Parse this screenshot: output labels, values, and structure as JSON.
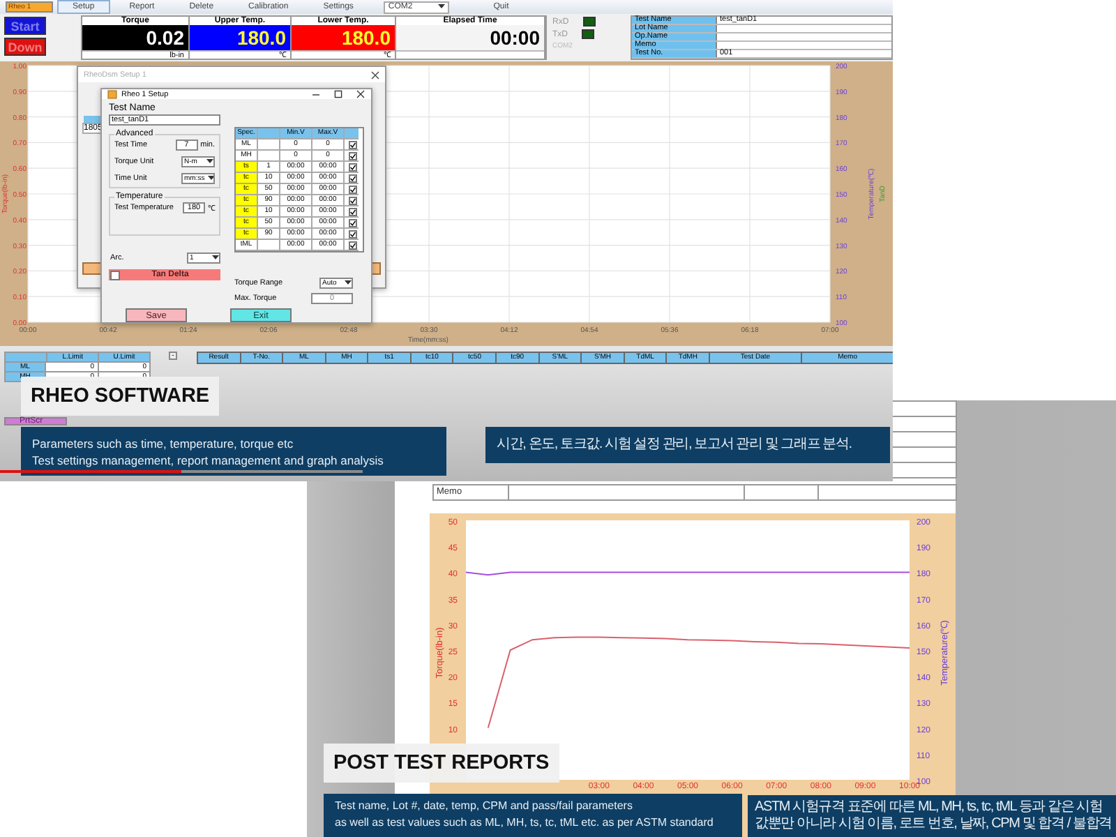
{
  "software": {
    "menu": [
      {
        "label": "Rheo 1",
        "selected": true,
        "focused": false
      },
      {
        "label": "Setup",
        "selected": false,
        "focused": true
      },
      {
        "label": "Report",
        "selected": false,
        "focused": false
      },
      {
        "label": "Delete",
        "selected": false,
        "focused": false
      },
      {
        "label": "Calibration",
        "selected": false,
        "focused": false
      },
      {
        "label": "Settings",
        "selected": false,
        "focused": false
      }
    ],
    "port": "COM2",
    "quit": "Quit",
    "buttons": [
      {
        "label": "Start",
        "color": "#1414d8"
      },
      {
        "label": "Down",
        "color": "#e01010"
      }
    ],
    "gauges": [
      {
        "label": "Torque",
        "value": "0.02",
        "unit": "lb-in",
        "color": "#000000"
      },
      {
        "label": "Upper Temp.",
        "value": "180.0",
        "unit": "℃",
        "color": "#0000ff"
      },
      {
        "label": "Lower Temp.",
        "value": "180.0",
        "unit": "℃",
        "color": "#ff0000"
      },
      {
        "label": "Elapsed Time",
        "value": "00:00"
      }
    ],
    "leds": [
      {
        "label": "RxD"
      },
      {
        "label": "TxD"
      }
    ],
    "led_port": "COM2",
    "info": [
      {
        "label": "Test Name",
        "value": "test_tanD1"
      },
      {
        "label": "Lot Name"
      },
      {
        "label": "Op.Name"
      },
      {
        "label": "Memo"
      },
      {
        "label": "Test No.",
        "value": "001"
      }
    ],
    "chart": {
      "left_label": "Torque(lb-in)",
      "right_label": "Temperature(℃)",
      "extra_label": "TanD",
      "xlabel": "Time(mm:ss)",
      "left_ticks": [
        "1.00",
        "0.90",
        "0.80",
        "0.70",
        "0.60",
        "0.50",
        "0.40",
        "0.30",
        "0.20",
        "0.10",
        "0.00"
      ],
      "right_ticks": [
        "200",
        "190",
        "180",
        "170",
        "160",
        "150",
        "140",
        "130",
        "120",
        "110",
        "100"
      ],
      "x_ticks": [
        "00:00",
        "00:42",
        "01:24",
        "02:06",
        "02:48",
        "03:30",
        "04:12",
        "04:54",
        "05:36",
        "06:18",
        "07:00"
      ]
    },
    "limits": {
      "columns": [
        "L.Limit",
        "U.Limit"
      ],
      "rows": [
        {
          "name": "ML",
          "values": [
            "0",
            "0"
          ]
        },
        {
          "name": "MH",
          "values": [
            "0",
            "0"
          ]
        }
      ]
    },
    "print_button": "PrtScr",
    "collapse_button": "-",
    "results_columns": [
      "Result",
      "T-No.",
      "ML",
      "MH",
      "ts1",
      "tc10",
      "tc50",
      "tc90",
      "S'ML",
      "S'MH",
      "TdML",
      "TdMH",
      "Test Date",
      "Memo"
    ],
    "back_dialog": {
      "title": "RheoDsm Setup 1",
      "cell": "1805"
    },
    "setup": {
      "title": "Rheo 1 Setup",
      "test_name_label": "Test Name",
      "test_name": "test_tanD1",
      "advanced_label": "Advanced",
      "test_time_label": "Test Time",
      "test_time": "7",
      "test_time_unit": "min.",
      "torque_unit_label": "Torque Unit",
      "torque_unit": "N-m",
      "time_unit_label": "Time Unit",
      "time_unit": "mm:ss",
      "temperature_label": "Temperature",
      "test_temp_label": "Test Temperature",
      "test_temp": "180",
      "test_temp_unit": "℃",
      "arc_label": "Arc.",
      "arc": "1",
      "tan_delta": {
        "label": "Tan Delta",
        "checked": false
      },
      "torque_range_label": "Torque Range",
      "torque_range": "Auto",
      "max_torque_label": "Max. Torque",
      "max_torque": "0",
      "save": "Save",
      "exit": "Exit",
      "spec_columns": [
        "Spec.",
        "Min.V",
        "Max.V"
      ],
      "spec_rows": [
        {
          "spec": "ML",
          "min": "0",
          "max": "0",
          "checked": true,
          "highlighted": false
        },
        {
          "spec": "MH",
          "min": "0",
          "max": "0",
          "checked": true,
          "highlighted": false
        },
        {
          "spec": "ts",
          "param": "1",
          "min": "00:00",
          "max": "00:00",
          "checked": true,
          "highlighted": true
        },
        {
          "spec": "tc",
          "param": "10",
          "min": "00:00",
          "max": "00:00",
          "checked": true,
          "highlighted": true
        },
        {
          "spec": "tc",
          "param": "50",
          "min": "00:00",
          "max": "00:00",
          "checked": true,
          "highlighted": true
        },
        {
          "spec": "tc",
          "param": "90",
          "min": "00:00",
          "max": "00:00",
          "checked": true,
          "highlighted": true
        },
        {
          "spec": "tc",
          "param": "10",
          "min": "00:00",
          "max": "00:00",
          "checked": true,
          "highlighted": true
        },
        {
          "spec": "tc",
          "param": "50",
          "min": "00:00",
          "max": "00:00",
          "checked": true,
          "highlighted": true
        },
        {
          "spec": "tc",
          "param": "90",
          "min": "00:00",
          "max": "00:00",
          "checked": true,
          "highlighted": true
        },
        {
          "spec": "tML",
          "min": "00:00",
          "max": "00:00",
          "checked": true,
          "highlighted": false
        }
      ]
    },
    "caption": {
      "title": "RHEO SOFTWARE",
      "lines": [
        "Parameters such as time, temperature, torque etc",
        "Test settings management, report management and graph analysis"
      ],
      "translation": "시간, 온도, 토크값. 시험 설정 관리, 보고서 관리 및 그래프 분석."
    },
    "progress": {
      "level": 0.5
    }
  },
  "report": {
    "memo_label": "Memo",
    "chart_data": {
      "type": "line",
      "ylabel": "Torque(lb-in)",
      "ylim": [
        0,
        50
      ],
      "yticks": [
        10,
        15,
        20,
        25,
        30,
        35,
        40,
        45,
        50
      ],
      "x": [
        0.5,
        1,
        1.5,
        2,
        2.5,
        3,
        3.5,
        4,
        4.5,
        5,
        5.5,
        6,
        6.5,
        7,
        7.5,
        8,
        8.5,
        9,
        9.5,
        10
      ],
      "xlim": [
        0,
        10
      ],
      "xticks": [
        {
          "value": 3,
          "label": "03:00"
        },
        {
          "value": 4,
          "label": "04:00"
        },
        {
          "value": 5,
          "label": "05:00"
        },
        {
          "value": 6,
          "label": "06:00"
        },
        {
          "value": 7,
          "label": "07:00"
        },
        {
          "value": 8,
          "label": "08:00"
        },
        {
          "value": 9,
          "label": "09:00"
        },
        {
          "value": 10,
          "label": "10:00"
        }
      ],
      "values": [
        10,
        25,
        27,
        27.4,
        27.5,
        27.5,
        27.4,
        27.3,
        27.2,
        27.0,
        26.9,
        26.8,
        26.6,
        26.5,
        26.3,
        26.2,
        26.0,
        25.8,
        25.6,
        25.4
      ]
    },
    "temperature_chart": {
      "chart_data": {
        "type": "line",
        "ylabel": "Temperature(℃)",
        "ylim": [
          100,
          200
        ],
        "yticks": [
          100,
          110,
          120,
          130,
          140,
          150,
          160,
          170,
          180,
          190,
          200
        ],
        "x": [
          0,
          0.5,
          1,
          1.5,
          2,
          2.5,
          3,
          3.5,
          4,
          4.5,
          5,
          5.5,
          6,
          6.5,
          7,
          7.5,
          8,
          8.5,
          9,
          9.5,
          10
        ],
        "xlim": [
          0,
          10
        ],
        "values": [
          180,
          179,
          180,
          180,
          180,
          180,
          180,
          180,
          180,
          180,
          180,
          180,
          180,
          180,
          180,
          180,
          180,
          180,
          180,
          180,
          180
        ]
      }
    },
    "caption": {
      "title": "POST TEST REPORTS",
      "lines": [
        "Test name, Lot #, date, temp, CPM and pass/fail parameters",
        "as well as test values such as ML, MH, ts, tc, tML etc. as per ASTM standard"
      ],
      "translation": [
        "ASTM 시험규격 표준에 따른 ML, MH, ts, tc, tML 등과 같은 시험",
        "값뿐만 아니라 시험 이름, 로트 번호, 날짜, CPM 및 합격 / 불합격"
      ]
    }
  }
}
